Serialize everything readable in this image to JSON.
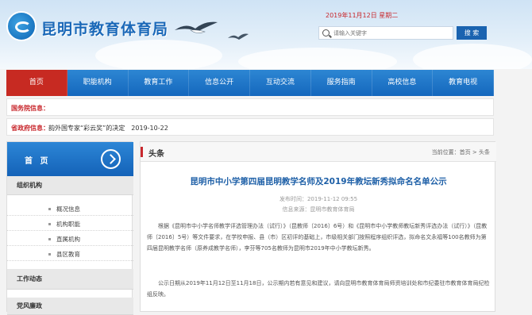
{
  "site": {
    "title": "昆明市教育体育局",
    "date": "2019年11月12日 星期二"
  },
  "search": {
    "placeholder": "请输入关键字",
    "button": "搜 索"
  },
  "nav": [
    {
      "label": "首页",
      "active": true
    },
    {
      "label": "职能机构"
    },
    {
      "label": "教育工作"
    },
    {
      "label": "信息公开"
    },
    {
      "label": "互动交流"
    },
    {
      "label": "服务指南"
    },
    {
      "label": "高校信息"
    },
    {
      "label": "教育电视"
    }
  ],
  "notices": [
    {
      "label": "国务院信息：",
      "text": "",
      "date": ""
    },
    {
      "label": "省政府信息：",
      "text": "韵外国专家“彩云奖”的决定",
      "date": "2019-10-22"
    }
  ],
  "sidebar": {
    "head": "首 页",
    "groups": [
      {
        "label": "组织机构",
        "items": [
          "概况信息",
          "机构职能",
          "直属机构",
          "县区教育"
        ]
      },
      {
        "label": "工作动态",
        "items": []
      },
      {
        "label": "党风廉政",
        "items": []
      }
    ]
  },
  "main": {
    "section": "头条",
    "breadcrumb": "当前位置：首页 > 头条",
    "article_title": "昆明市中小学第四届昆明教学名师及2019年教坛新秀拟命名名单公示",
    "publish_time": "发布时间：2019-11-12 09:55",
    "source": "信息来源：昆明市教育体育局",
    "paragraphs": [
      "根据《昆明市中小学名师教学评选管理办法（试行）》（昆教师〔2016〕6号）和《昆明市中小学教师教坛新秀评选办法（试行）》（昆教师〔2016〕5号）等文件要求，在学校申报、县（市）区初评的基础上，市级相关部门按照程序组织评选，拟命名文永福等100名教师为第四届昆明教学名师（原养成教学名师），李芬等705名教师为昆明市2019年中小学教坛新秀。",
      "公示日期从2019年11月12日至11月18日，公示期内若有意见和建议，请向昆明市教育体育局师资培训处和市纪委驻市教育体育局纪检组反映。"
    ]
  },
  "colors": {
    "nav_blue": "#1a6ec3",
    "active_red": "#c72a22",
    "title_blue": "#1d5fa7"
  }
}
